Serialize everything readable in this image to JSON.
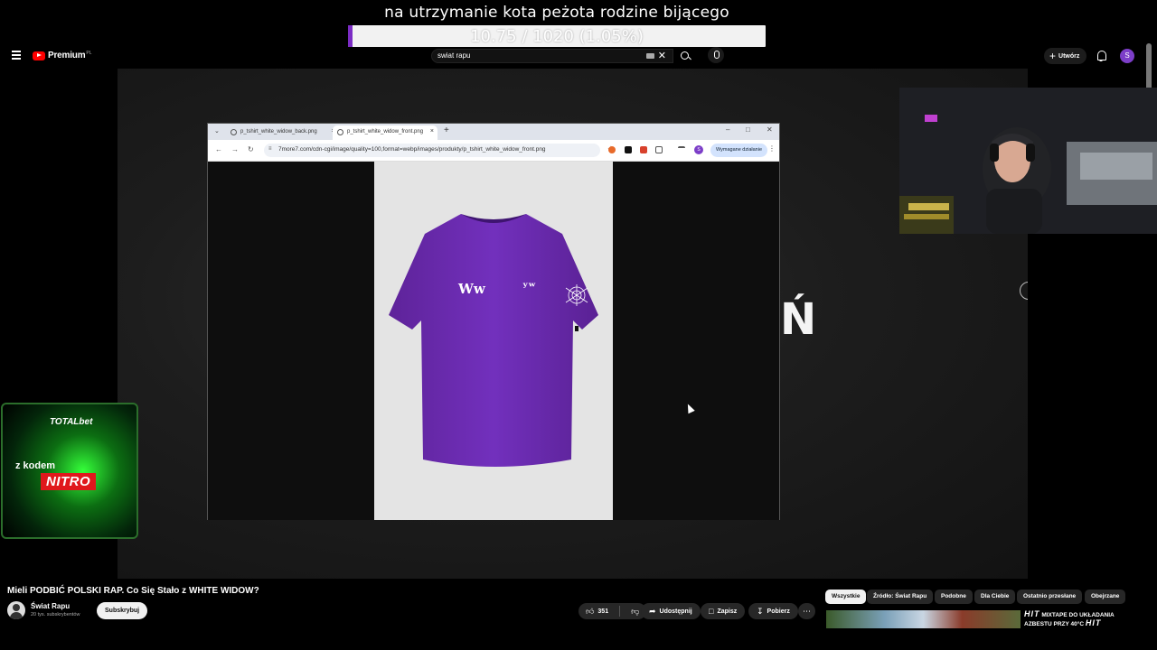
{
  "overlay": {
    "donation_message": "na utrzymanie kota peżota rodzine bijącego",
    "goal_text": "10.75 / 1020 (1.05%)",
    "goal_progress_percent": 1.05,
    "goal_fill_color": "#7b2cc4"
  },
  "header": {
    "logo_text": "Premium",
    "country_code": "PL",
    "search_value": "swiat rapu",
    "clear_glyph": "✕",
    "create_label": "Utwórz",
    "avatar_letter": "S"
  },
  "video": {
    "overlay_letter": "Ń"
  },
  "browser": {
    "tab1_title": "p_tshirt_white_widow_back.png",
    "tab2_title": "p_tshirt_white_widow_front.png",
    "url": "7more7.com/cdn-cgi/image/quality=100,format=webp/images/produkty/p_tshirt_white_widow_front.png",
    "action_label": "Wymagane działanie",
    "profile_letter": "S",
    "shirt_color": "#6f2bb5",
    "shirt_print_left": "Ww",
    "shirt_print_right": "ʸʷ"
  },
  "ad": {
    "brand": "TOTALbet",
    "line1": "z kodem",
    "code": "NITRO"
  },
  "below": {
    "title": "Mieli PODBIĆ POLSKI RAP. Co Się Stało z WHITE WIDOW?",
    "channel_name": "Świat Rapu",
    "subscribers": "20 tys. subskrybentów",
    "subscribe_label": "Subskrybuj",
    "like_count": "351",
    "share_label": "Udostępnij",
    "save_label": "Zapisz",
    "download_label": "Pobierz"
  },
  "chips": [
    {
      "label": "Wszystkie",
      "active": true
    },
    {
      "label": "Źródło: Świat Rapu",
      "active": false
    },
    {
      "label": "Podobne",
      "active": false
    },
    {
      "label": "Dla Ciebie",
      "active": false
    },
    {
      "label": "Ostatnio przesłane",
      "active": false
    },
    {
      "label": "Obejrzane",
      "active": false
    }
  ],
  "recommendation": {
    "line1_brand": "HIT",
    "line1_text": "MIXTAPE DO UKŁADANIA",
    "line2_text": "AZBESTU PRZY 40°C",
    "line2_brand": "HIT"
  }
}
